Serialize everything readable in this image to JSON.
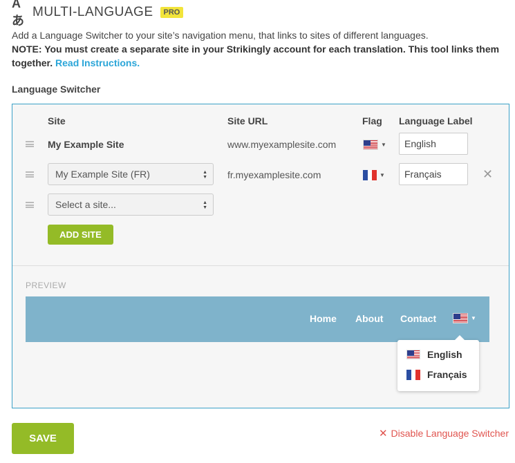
{
  "header": {
    "icon": "translate-icon",
    "icon_glyph": "Aあ",
    "title": "MULTI-LANGUAGE",
    "badge": "PRO"
  },
  "intro": {
    "text": "Add a Language Switcher to your site’s navigation menu, that links to sites of different languages.",
    "note": "NOTE: You must create a separate site in your Strikingly account for each translation. This tool links them together.",
    "link": "Read Instructions."
  },
  "section_label": "Language Switcher",
  "table": {
    "headers": {
      "site": "Site",
      "site_url": "Site URL",
      "flag": "Flag",
      "language_label": "Language Label"
    },
    "rows": [
      {
        "site": "My Example Site",
        "url": "www.myexamplesite.com",
        "flag": "us",
        "label": "English",
        "removable": false
      },
      {
        "site": "My Example Site (FR)",
        "url": "fr.myexamplesite.com",
        "flag": "fr",
        "label": "Français",
        "removable": true
      }
    ],
    "new_row": {
      "placeholder": "Select a site..."
    }
  },
  "add_site_label": "ADD SITE",
  "preview": {
    "label": "PREVIEW",
    "nav": [
      "Home",
      "About",
      "Contact"
    ],
    "dropdown": [
      {
        "flag": "us",
        "label": "English"
      },
      {
        "flag": "fr",
        "label": "Français"
      }
    ],
    "nav_bg_color": "#7fb3cb"
  },
  "save_label": "SAVE",
  "disable_label": "Disable Language Switcher",
  "colors": {
    "accent_green": "#94bb27",
    "link_blue": "#2aa5d8",
    "danger_red": "#e0544f",
    "panel_border": "#3aa0c6",
    "badge_yellow": "#f2e43a"
  }
}
